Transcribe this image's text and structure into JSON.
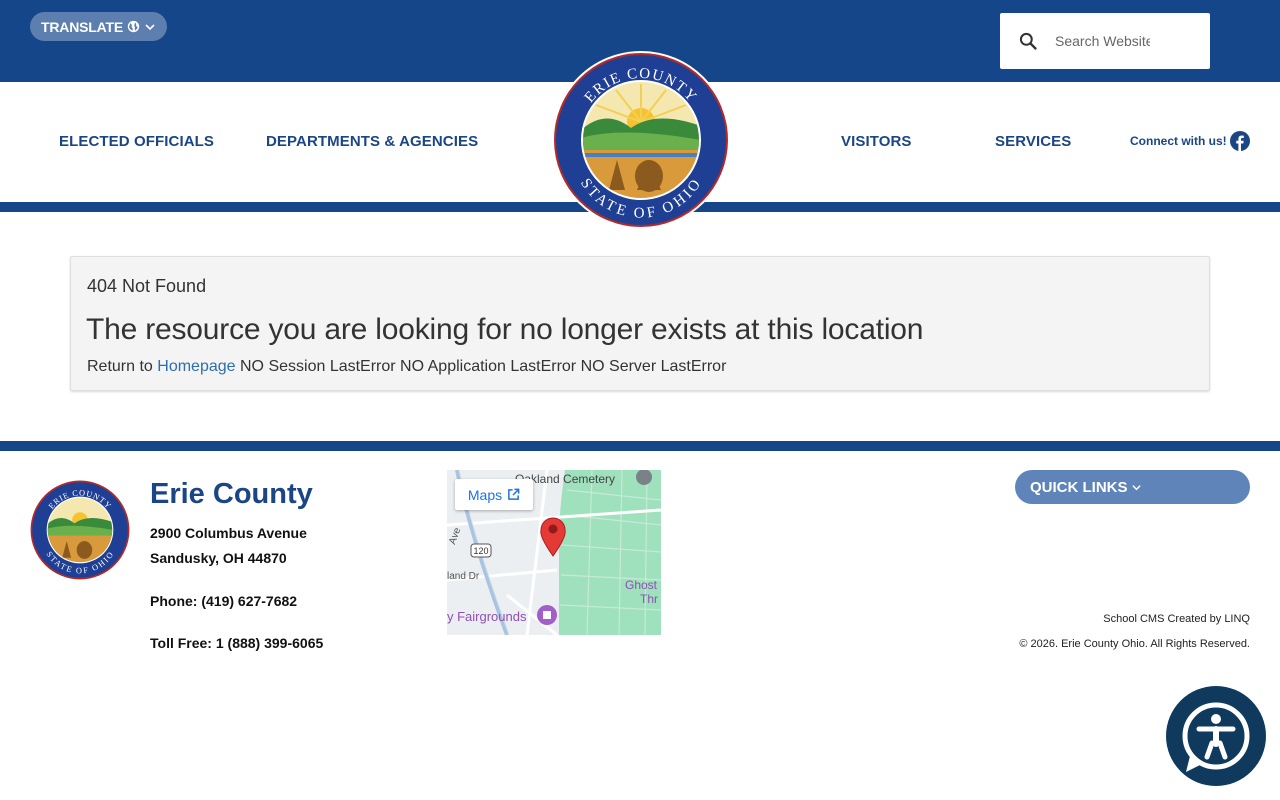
{
  "header": {
    "translate_label": "TRANSLATE",
    "search_placeholder": "Search Website"
  },
  "nav": {
    "items": [
      {
        "label": "ELECTED OFFICIALS"
      },
      {
        "label": "DEPARTMENTS & AGENCIES"
      },
      {
        "label": "VISITORS"
      },
      {
        "label": "SERVICES"
      }
    ],
    "connect_label": "Connect with us!"
  },
  "seal": {
    "top_text": "ERIE COUNTY",
    "bottom_text": "STATE OF OHIO"
  },
  "error": {
    "code": "404 Not Found",
    "title": "The resource you are looking for no longer exists at this location",
    "return_prefix": "Return to",
    "homepage_link": "Homepage",
    "suffix": "NO Session LastError NO Application LastError NO Server LastError"
  },
  "footer": {
    "name": "Erie County",
    "address_line1": "2900 Columbus Avenue",
    "address_line2": "Sandusky, OH 44870",
    "phone": "Phone: (419) 627-7682",
    "toll_free": "Toll Free: 1 (888) 399-6065",
    "quick_links_label": "QUICK LINKS",
    "cms_credit": "School CMS Created by LINQ",
    "copyright": "© 2026. Erie County Ohio. All Rights Reserved."
  },
  "map": {
    "maps_button": "Maps",
    "label_cemetery": "Oakland Cemetery",
    "label_route": "120",
    "label_ave": "Ave",
    "label_land_dr": "land Dr",
    "label_fairgrounds": "y Fairgrounds",
    "label_ghost": "Ghost",
    "label_thr": "Thr"
  },
  "colors": {
    "brand_blue": "#16468a",
    "nav_text": "#1b4585",
    "pill_blue": "#5f84b9",
    "link_blue": "#2e6ead"
  }
}
